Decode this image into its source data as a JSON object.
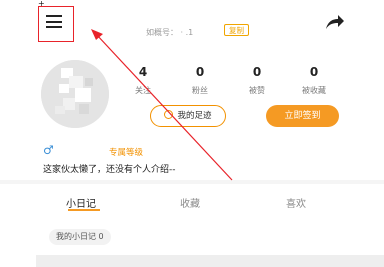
{
  "header": {
    "account_id_label": "如概号：  ·  .1",
    "copy_label": "复制"
  },
  "stats": [
    {
      "value": "4",
      "label": "关注"
    },
    {
      "value": "0",
      "label": "粉丝"
    },
    {
      "value": "0",
      "label": "被赞"
    },
    {
      "value": "0",
      "label": "被收藏"
    }
  ],
  "actions": {
    "footprint_label": "我的足迹",
    "checkin_label": "立即签到"
  },
  "profile": {
    "gender_symbol": "♂",
    "level_label": "专属等级",
    "bio": "这家伙太懒了，还没有个人介绍--"
  },
  "tabs": [
    {
      "label": "小日记",
      "active": true
    },
    {
      "label": "收藏",
      "active": false
    },
    {
      "label": "喜欢",
      "active": false
    }
  ],
  "diary_chip": "我的小日记 0",
  "colors": {
    "accent": "#f59a23",
    "annotation_red": "#e8232a",
    "male_blue": "#3b8fd6"
  }
}
